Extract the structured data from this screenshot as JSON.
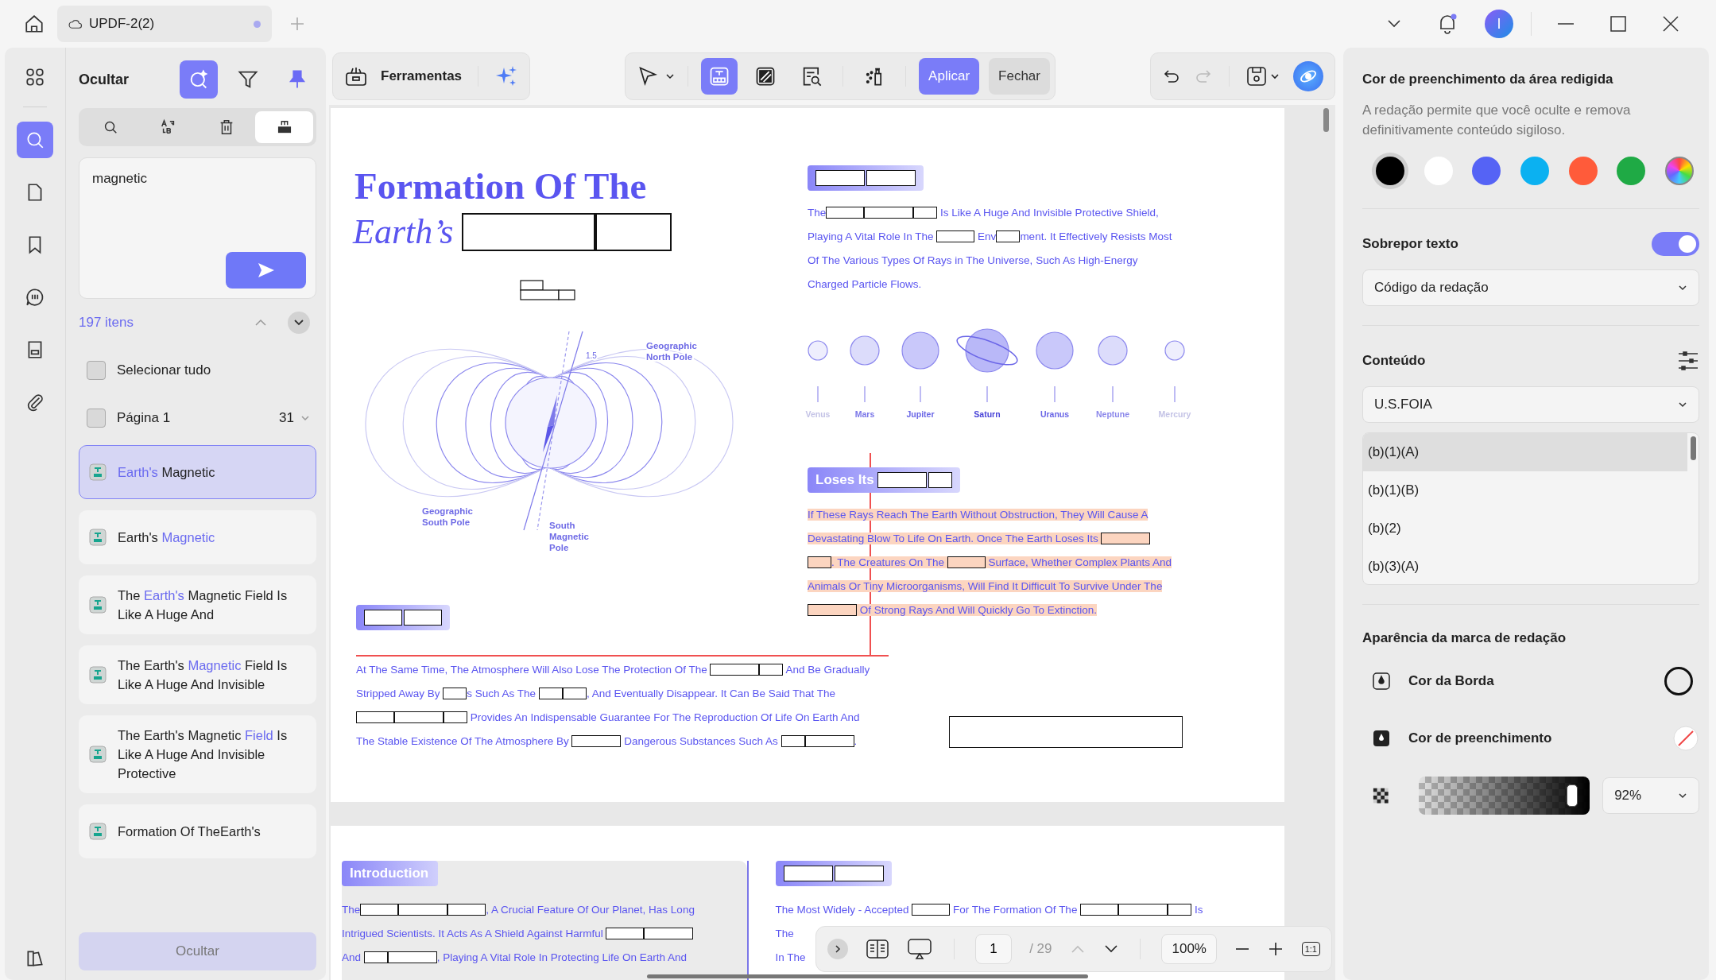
{
  "tab": {
    "title": "UPDF-2(2)",
    "unsaved": true
  },
  "topbar": {
    "avatar": "I",
    "notification": true
  },
  "rail": [
    {
      "kind": "apps",
      "selected": false
    },
    {
      "kind": "search",
      "selected": true
    },
    {
      "kind": "pages",
      "selected": false
    },
    {
      "kind": "bookmark",
      "selected": false
    },
    {
      "kind": "comment",
      "selected": false
    },
    {
      "kind": "form",
      "selected": false
    },
    {
      "kind": "attachment",
      "selected": false
    }
  ],
  "panel": {
    "title": "Ocultar",
    "header_tools": [
      {
        "kind": "ai-search",
        "selected": true
      },
      {
        "kind": "filter",
        "selected": false
      },
      {
        "kind": "pin",
        "selected": true
      }
    ],
    "mode_tabs": [
      {
        "kind": "search",
        "selected": false
      },
      {
        "kind": "replace",
        "selected": false
      },
      {
        "kind": "delete",
        "selected": false
      },
      {
        "kind": "redact",
        "selected": true
      }
    ],
    "search": {
      "value": "magnetic"
    },
    "count": "197 itens",
    "select_all": {
      "label": "Selecionar tudo",
      "checked": false
    },
    "page_group": {
      "label": "Página 1",
      "checked": false,
      "count": "31"
    },
    "results": [
      {
        "selected": true,
        "parts": [
          {
            "text": "Earth's",
            "match": true
          },
          {
            "text": " Magnetic",
            "match": false
          }
        ]
      },
      {
        "selected": false,
        "parts": [
          {
            "text": "Earth's ",
            "match": false
          },
          {
            "text": "Magnetic",
            "match": true
          }
        ]
      },
      {
        "selected": false,
        "parts": [
          {
            "text": "The ",
            "match": false
          },
          {
            "text": "Earth's",
            "match": true
          },
          {
            "text": " Magnetic Field Is Like A Huge And",
            "match": false
          }
        ]
      },
      {
        "selected": false,
        "parts": [
          {
            "text": "The Earth's ",
            "match": false
          },
          {
            "text": "Magnetic",
            "match": true
          },
          {
            "text": " Field Is Like A Huge And Invisible",
            "match": false
          }
        ]
      },
      {
        "selected": false,
        "parts": [
          {
            "text": "The Earth's Magnetic ",
            "match": false
          },
          {
            "text": "Field",
            "match": true
          },
          {
            "text": " Is Like A Huge And Invisible Protective",
            "match": false
          }
        ]
      },
      {
        "selected": false,
        "parts": [
          {
            "text": "Formation Of TheEarth's",
            "match": false
          }
        ]
      }
    ],
    "hide_button": {
      "label": "Ocultar",
      "disabled": true
    }
  },
  "toolbar": {
    "tools_label": "Ferramentas",
    "tools": [
      {
        "kind": "select",
        "selected": false
      },
      {
        "kind": "redact-text",
        "selected": true
      },
      {
        "kind": "redact-area",
        "selected": false
      },
      {
        "kind": "find-redact",
        "selected": false
      },
      {
        "kind": "clear",
        "selected": false
      }
    ],
    "apply": "Aplicar",
    "close": "Fechar",
    "redo_disabled": true
  },
  "page1": {
    "title": "Formation Of The",
    "title_line2": [
      {
        "kind": "text",
        "text": "Earth’s "
      },
      {
        "kind": "box-xxl"
      },
      {
        "kind": "box-xl"
      }
    ],
    "right_header": [
      {
        "kind": "box-l"
      },
      {
        "kind": "box-l"
      }
    ],
    "right_para": {
      "highlighted": false,
      "lines": [
        [
          {
            "kind": "text",
            "text": "The"
          },
          {
            "kind": "box-m"
          },
          {
            "kind": "box-l"
          },
          {
            "kind": "box-s"
          },
          {
            "kind": "text",
            "text": " Is Like A Huge And Invisible Protective Shield,"
          }
        ],
        [
          {
            "kind": "text",
            "text": "Playing A Vital Role In The "
          },
          {
            "kind": "box-m"
          },
          {
            "kind": "text",
            "text": " Env"
          },
          {
            "kind": "box-s"
          },
          {
            "kind": "text",
            "text": "ment. It Effectively Resists Most"
          }
        ],
        [
          {
            "kind": "text",
            "text": "Of The Various Types Of Rays in The Universe, Such As High-Energy"
          }
        ],
        [
          {
            "kind": "text",
            "text": "Charged Particle Flows."
          }
        ]
      ]
    },
    "diagram_labels": [
      {
        "lines": [
          "1.5"
        ]
      },
      {
        "lines": [
          "Geographic",
          "North Pole"
        ]
      },
      {
        "lines": [
          "Geographic",
          "South Pole"
        ]
      },
      {
        "lines": [
          "South",
          "Magnetic",
          "Pole"
        ]
      }
    ],
    "planets": [
      {
        "name": "Venus"
      },
      {
        "name": "Mars"
      },
      {
        "name": "Jupiter"
      },
      {
        "name": "Saturn"
      },
      {
        "name": "Uranus"
      },
      {
        "name": "Neptune"
      },
      {
        "name": "Mercury"
      }
    ],
    "loses_header": [
      {
        "kind": "text",
        "text": "Loses Its"
      },
      {
        "kind": "box-l"
      },
      {
        "kind": "box-s"
      }
    ],
    "loses_para": {
      "highlighted": true,
      "lines": [
        [
          {
            "kind": "text",
            "text": "If These Rays Reach The Earth Without Obstruction, They Will Cause A"
          }
        ],
        [
          {
            "kind": "text",
            "text": "Devastating Blow To Life On Earth. Once The Earth Loses Its "
          },
          {
            "kind": "box-l"
          }
        ],
        [
          {
            "kind": "box-s"
          },
          {
            "kind": "text",
            "text": ". The Creatures On The "
          },
          {
            "kind": "box-m"
          },
          {
            "kind": "text",
            "text": " Surface, Whether Complex Plants And"
          }
        ],
        [
          {
            "kind": "text",
            "text": "Animals Or Tiny Microorganisms, Will Find It Difficult To Survive Under The"
          }
        ],
        [
          {
            "kind": "box-l"
          },
          {
            "kind": "text",
            "text": " Of Strong Rays And Will Quickly Go To Extinction."
          }
        ]
      ]
    },
    "left_header": [
      {
        "kind": "box-m"
      },
      {
        "kind": "box-m"
      }
    ],
    "bottom_para": {
      "highlighted": false,
      "lines": [
        [
          {
            "kind": "text",
            "text": "At The Same Time, The Atmosphere Will Also Lose The Protection Of The "
          },
          {
            "kind": "box-l"
          },
          {
            "kind": "box-s"
          },
          {
            "kind": "text",
            "text": " And Be Gradually"
          }
        ],
        [
          {
            "kind": "text",
            "text": "Stripped Away By "
          },
          {
            "kind": "box-s"
          },
          {
            "kind": "text",
            "text": "s Such As The "
          },
          {
            "kind": "box-s"
          },
          {
            "kind": "box-s"
          },
          {
            "kind": "text",
            "text": ", And Eventually Disappear. It Can Be Said That The"
          }
        ],
        [
          {
            "kind": "box-m"
          },
          {
            "kind": "box-l"
          },
          {
            "kind": "box-s"
          },
          {
            "kind": "text",
            "text": " Provides An Indispensable Guarantee For The Reproduction Of Life On Earth And"
          }
        ],
        [
          {
            "kind": "text",
            "text": "The Stable Existence Of The Atmosphere By "
          },
          {
            "kind": "box-l"
          },
          {
            "kind": "text",
            "text": " Dangerous Substances Such As "
          },
          {
            "kind": "box-s"
          },
          {
            "kind": "box-l"
          },
          {
            "kind": "text",
            "text": "."
          }
        ]
      ]
    }
  },
  "page2": {
    "left_header": [
      {
        "kind": "text",
        "text": "Introduction"
      }
    ],
    "left_para": {
      "highlighted": false,
      "lines": [
        [
          {
            "kind": "text",
            "text": "The"
          },
          {
            "kind": "box-m"
          },
          {
            "kind": "box-l"
          },
          {
            "kind": "box-m"
          },
          {
            "kind": "text",
            "text": ", A Crucial Feature Of Our Planet, Has Long"
          }
        ],
        [
          {
            "kind": "text",
            "text": "Intrigued Scientists. It Acts As A Shield Against Harmful "
          },
          {
            "kind": "box-m"
          },
          {
            "kind": "box-l"
          }
        ],
        [
          {
            "kind": "text",
            "text": "And "
          },
          {
            "kind": "box-s"
          },
          {
            "kind": "box-l"
          },
          {
            "kind": "text",
            "text": ", Playing A Vital Role In Protecting Life On Earth And"
          }
        ]
      ]
    },
    "right_header": [
      {
        "kind": "box-l"
      },
      {
        "kind": "box-l"
      }
    ],
    "right_para": {
      "highlighted": false,
      "lines": [
        [
          {
            "kind": "text",
            "text": "The Most Widely - Accepted "
          },
          {
            "kind": "box-m"
          },
          {
            "kind": "text",
            "text": " For The Formation Of The "
          },
          {
            "kind": "box-m"
          },
          {
            "kind": "box-l"
          },
          {
            "kind": "box-s"
          },
          {
            "kind": "text",
            "text": " Is"
          }
        ],
        [
          {
            "kind": "text",
            "text": "The"
          }
        ],
        [
          {
            "kind": "text",
            "text": "In The"
          }
        ]
      ]
    }
  },
  "navbar": {
    "page": "1",
    "total": "/ 29",
    "zoom": "100%",
    "fit": "1:1",
    "prev_disabled": true
  },
  "redact_panel": {
    "fill_title": "Cor de preenchimento da área redigida",
    "fill_desc": "A redação permite que você oculte e remova definitivamente conteúdo sigiloso.",
    "swatches": [
      {
        "kind": "solid",
        "color": "#000000",
        "selected": true
      },
      {
        "kind": "solid",
        "color": "#ffffff",
        "selected": false
      },
      {
        "kind": "solid",
        "color": "#5563f5",
        "selected": false
      },
      {
        "kind": "solid",
        "color": "#0bb1f1",
        "selected": false
      },
      {
        "kind": "solid",
        "color": "#ff5b3a",
        "selected": false
      },
      {
        "kind": "solid",
        "color": "#1faa45",
        "selected": false
      },
      {
        "kind": "spectrum",
        "selected": false
      }
    ],
    "overlay_label": "Sobrepor texto",
    "overlay_on": true,
    "overlay_select": "Código da redação",
    "content_label": "Conteúdo",
    "content_select": "U.S.FOIA",
    "codes": [
      {
        "label": "(b)(1)(A)",
        "selected": true
      },
      {
        "label": "(b)(1)(B)",
        "selected": false
      },
      {
        "label": "(b)(2)",
        "selected": false
      },
      {
        "label": "(b)(3)(A)",
        "selected": false
      }
    ],
    "appearance_title": "Aparência da marca de redação",
    "border_label": "Cor da Borda",
    "fill_label": "Cor de preenchimento",
    "opacity": {
      "level": 0.92,
      "value": "92%"
    }
  }
}
